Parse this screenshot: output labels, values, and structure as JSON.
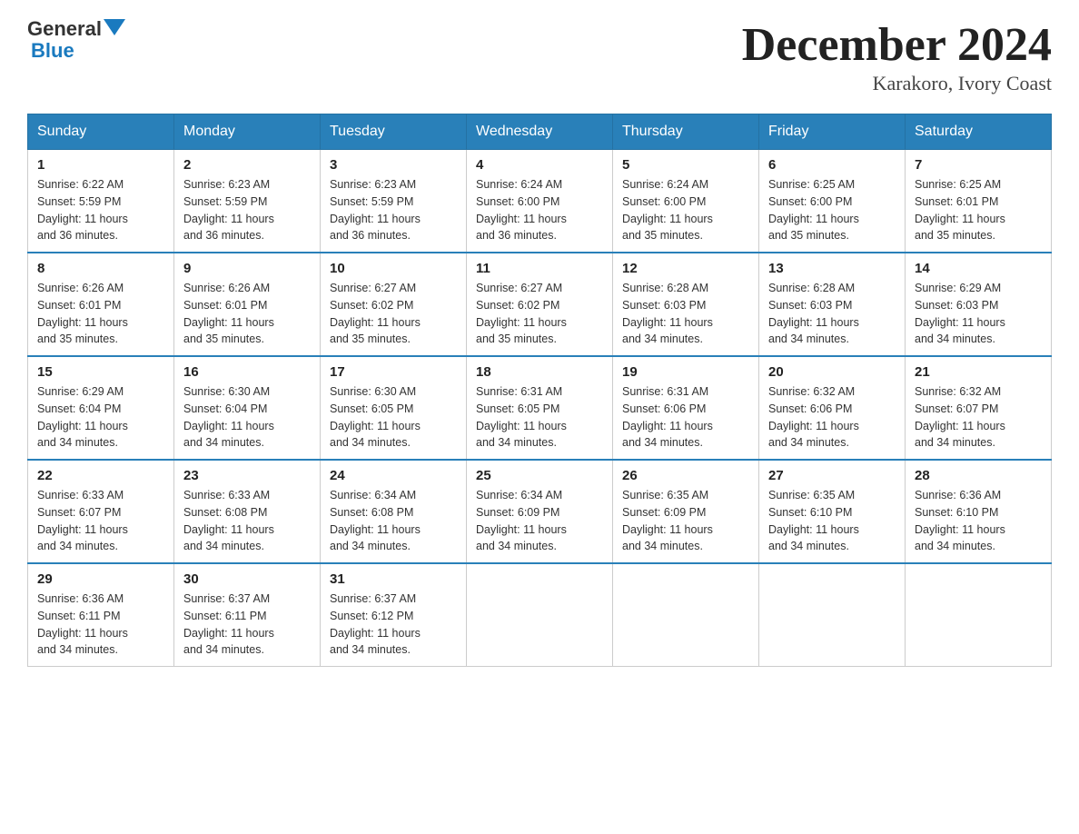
{
  "header": {
    "logo_text_main": "General",
    "logo_text_blue": "Blue",
    "month_title": "December 2024",
    "location": "Karakoro, Ivory Coast"
  },
  "weekdays": [
    "Sunday",
    "Monday",
    "Tuesday",
    "Wednesday",
    "Thursday",
    "Friday",
    "Saturday"
  ],
  "weeks": [
    [
      {
        "day": "1",
        "sunrise": "6:22 AM",
        "sunset": "5:59 PM",
        "daylight": "11 hours and 36 minutes."
      },
      {
        "day": "2",
        "sunrise": "6:23 AM",
        "sunset": "5:59 PM",
        "daylight": "11 hours and 36 minutes."
      },
      {
        "day": "3",
        "sunrise": "6:23 AM",
        "sunset": "5:59 PM",
        "daylight": "11 hours and 36 minutes."
      },
      {
        "day": "4",
        "sunrise": "6:24 AM",
        "sunset": "6:00 PM",
        "daylight": "11 hours and 36 minutes."
      },
      {
        "day": "5",
        "sunrise": "6:24 AM",
        "sunset": "6:00 PM",
        "daylight": "11 hours and 35 minutes."
      },
      {
        "day": "6",
        "sunrise": "6:25 AM",
        "sunset": "6:00 PM",
        "daylight": "11 hours and 35 minutes."
      },
      {
        "day": "7",
        "sunrise": "6:25 AM",
        "sunset": "6:01 PM",
        "daylight": "11 hours and 35 minutes."
      }
    ],
    [
      {
        "day": "8",
        "sunrise": "6:26 AM",
        "sunset": "6:01 PM",
        "daylight": "11 hours and 35 minutes."
      },
      {
        "day": "9",
        "sunrise": "6:26 AM",
        "sunset": "6:01 PM",
        "daylight": "11 hours and 35 minutes."
      },
      {
        "day": "10",
        "sunrise": "6:27 AM",
        "sunset": "6:02 PM",
        "daylight": "11 hours and 35 minutes."
      },
      {
        "day": "11",
        "sunrise": "6:27 AM",
        "sunset": "6:02 PM",
        "daylight": "11 hours and 35 minutes."
      },
      {
        "day": "12",
        "sunrise": "6:28 AM",
        "sunset": "6:03 PM",
        "daylight": "11 hours and 34 minutes."
      },
      {
        "day": "13",
        "sunrise": "6:28 AM",
        "sunset": "6:03 PM",
        "daylight": "11 hours and 34 minutes."
      },
      {
        "day": "14",
        "sunrise": "6:29 AM",
        "sunset": "6:03 PM",
        "daylight": "11 hours and 34 minutes."
      }
    ],
    [
      {
        "day": "15",
        "sunrise": "6:29 AM",
        "sunset": "6:04 PM",
        "daylight": "11 hours and 34 minutes."
      },
      {
        "day": "16",
        "sunrise": "6:30 AM",
        "sunset": "6:04 PM",
        "daylight": "11 hours and 34 minutes."
      },
      {
        "day": "17",
        "sunrise": "6:30 AM",
        "sunset": "6:05 PM",
        "daylight": "11 hours and 34 minutes."
      },
      {
        "day": "18",
        "sunrise": "6:31 AM",
        "sunset": "6:05 PM",
        "daylight": "11 hours and 34 minutes."
      },
      {
        "day": "19",
        "sunrise": "6:31 AM",
        "sunset": "6:06 PM",
        "daylight": "11 hours and 34 minutes."
      },
      {
        "day": "20",
        "sunrise": "6:32 AM",
        "sunset": "6:06 PM",
        "daylight": "11 hours and 34 minutes."
      },
      {
        "day": "21",
        "sunrise": "6:32 AM",
        "sunset": "6:07 PM",
        "daylight": "11 hours and 34 minutes."
      }
    ],
    [
      {
        "day": "22",
        "sunrise": "6:33 AM",
        "sunset": "6:07 PM",
        "daylight": "11 hours and 34 minutes."
      },
      {
        "day": "23",
        "sunrise": "6:33 AM",
        "sunset": "6:08 PM",
        "daylight": "11 hours and 34 minutes."
      },
      {
        "day": "24",
        "sunrise": "6:34 AM",
        "sunset": "6:08 PM",
        "daylight": "11 hours and 34 minutes."
      },
      {
        "day": "25",
        "sunrise": "6:34 AM",
        "sunset": "6:09 PM",
        "daylight": "11 hours and 34 minutes."
      },
      {
        "day": "26",
        "sunrise": "6:35 AM",
        "sunset": "6:09 PM",
        "daylight": "11 hours and 34 minutes."
      },
      {
        "day": "27",
        "sunrise": "6:35 AM",
        "sunset": "6:10 PM",
        "daylight": "11 hours and 34 minutes."
      },
      {
        "day": "28",
        "sunrise": "6:36 AM",
        "sunset": "6:10 PM",
        "daylight": "11 hours and 34 minutes."
      }
    ],
    [
      {
        "day": "29",
        "sunrise": "6:36 AM",
        "sunset": "6:11 PM",
        "daylight": "11 hours and 34 minutes."
      },
      {
        "day": "30",
        "sunrise": "6:37 AM",
        "sunset": "6:11 PM",
        "daylight": "11 hours and 34 minutes."
      },
      {
        "day": "31",
        "sunrise": "6:37 AM",
        "sunset": "6:12 PM",
        "daylight": "11 hours and 34 minutes."
      },
      null,
      null,
      null,
      null
    ]
  ]
}
